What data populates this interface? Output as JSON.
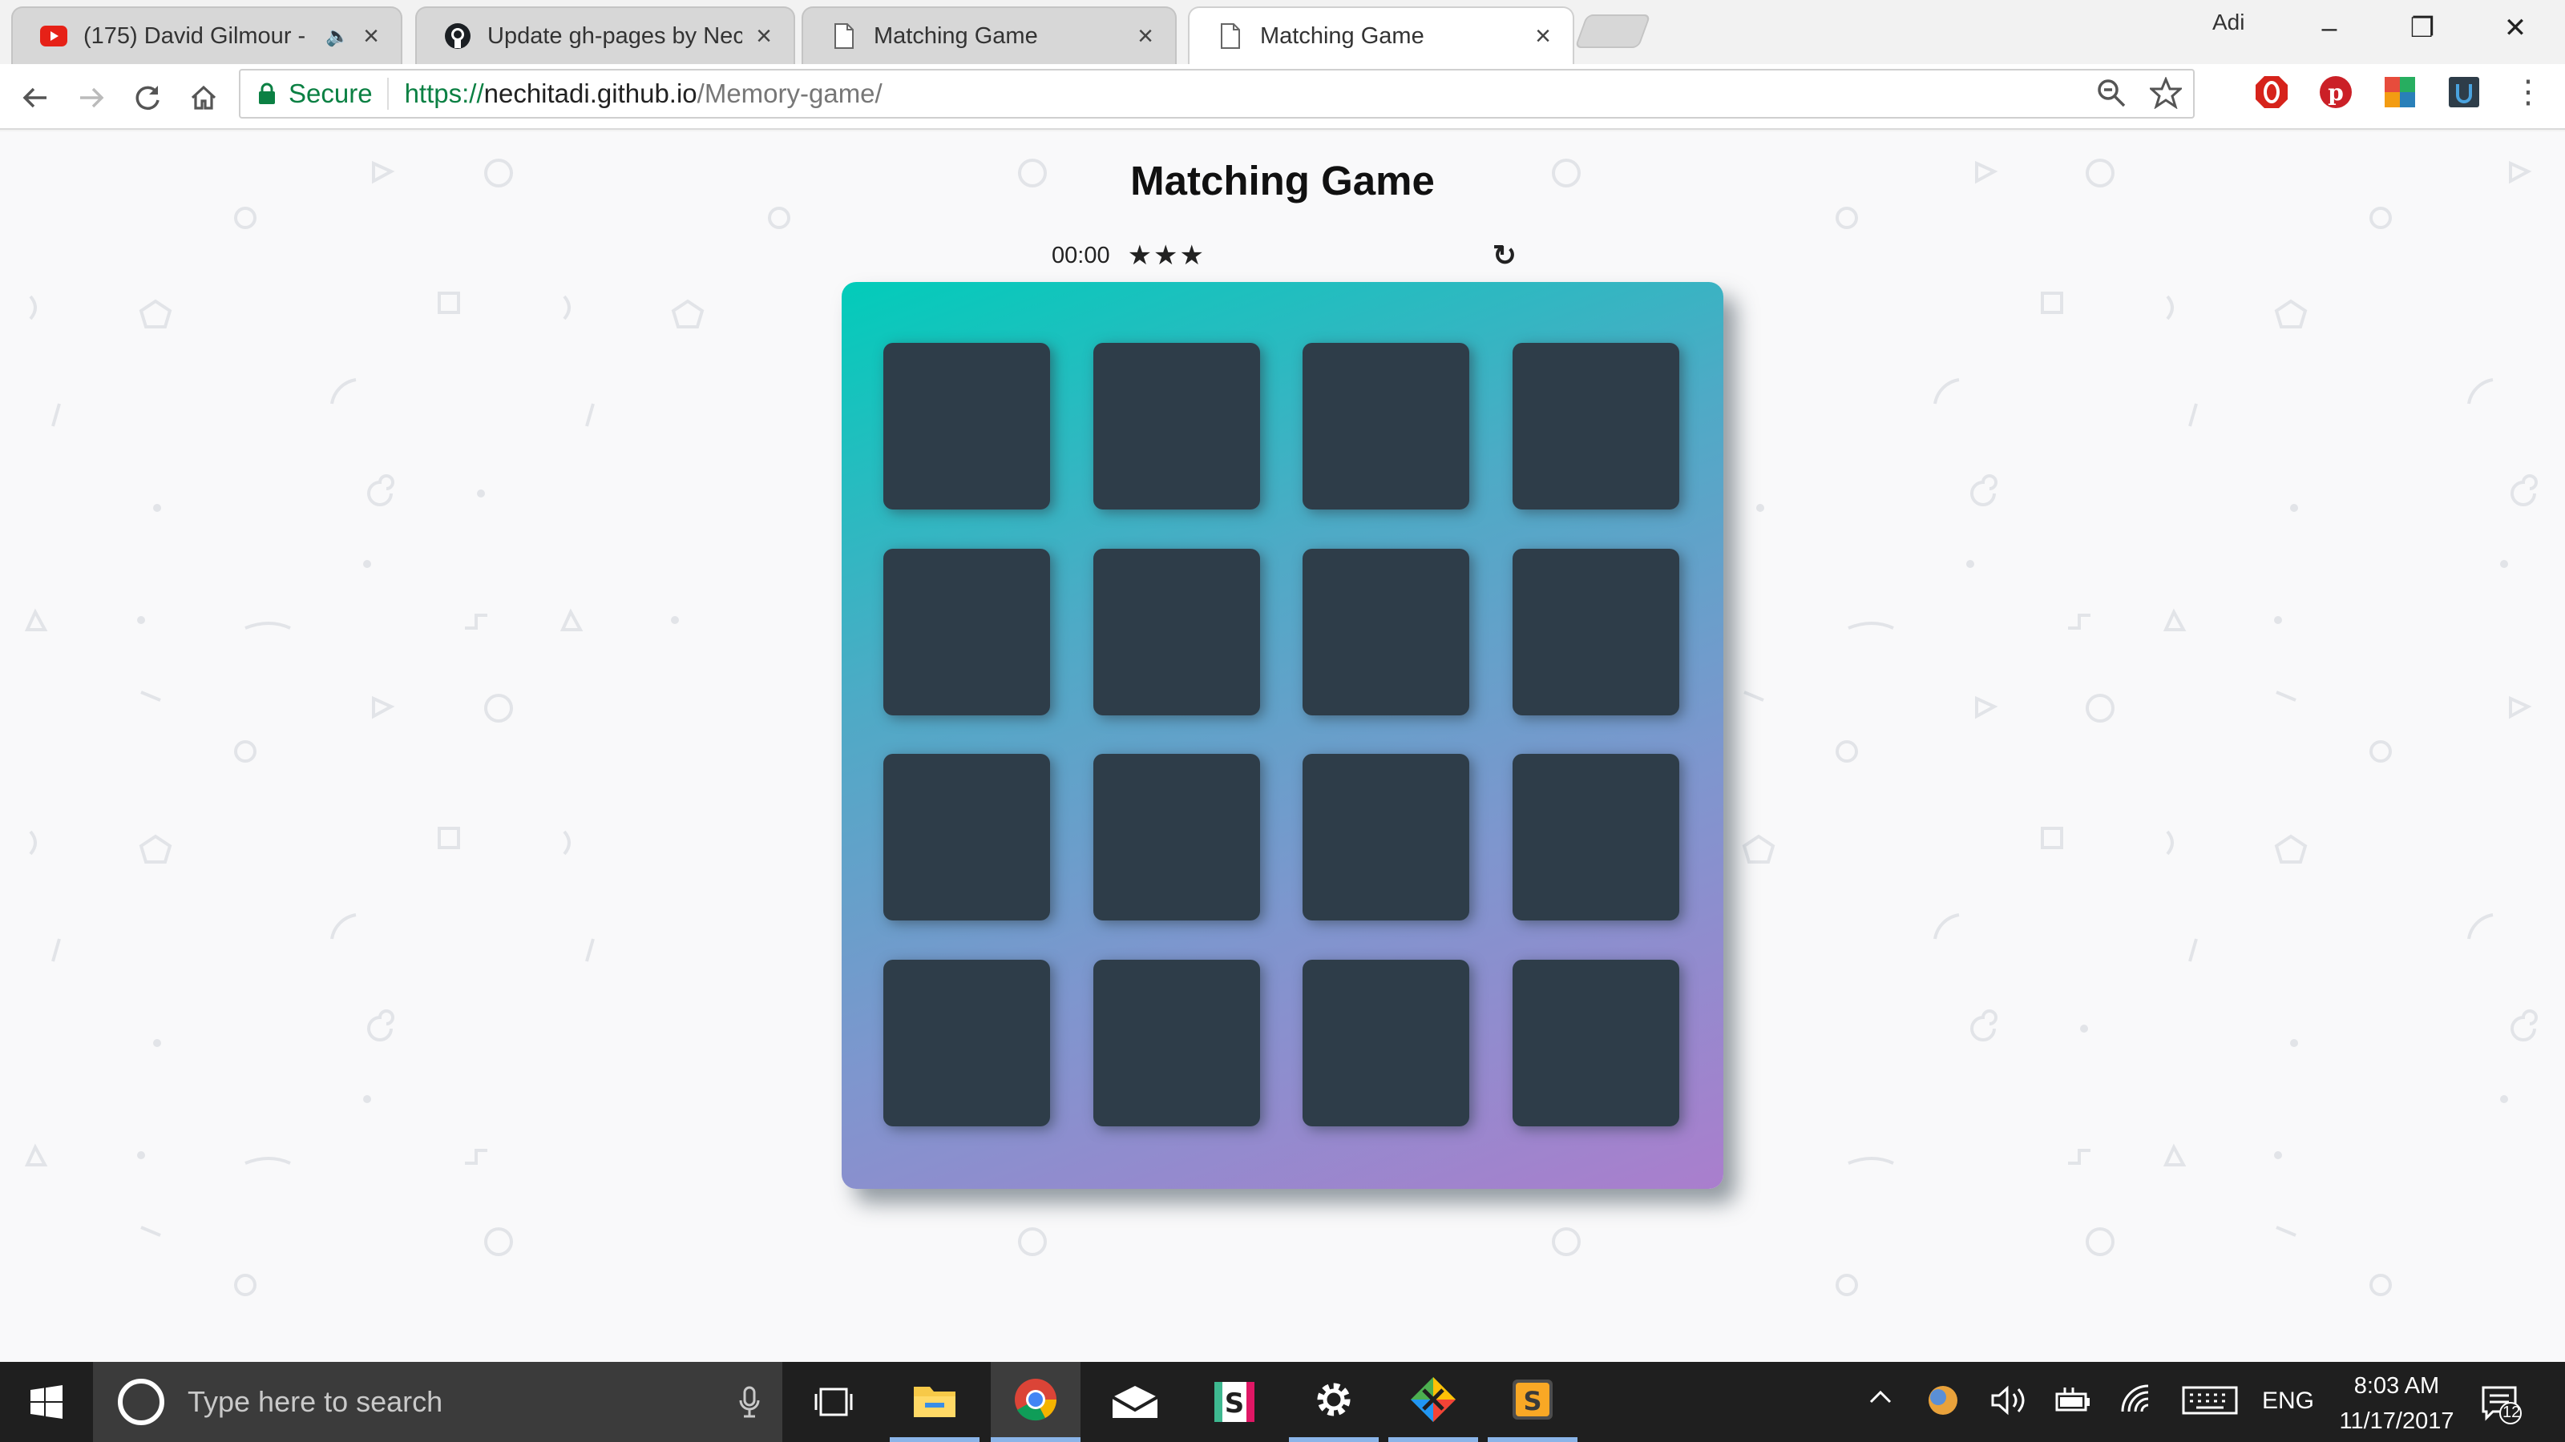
{
  "browser": {
    "tabs": [
      {
        "title": "(175) David Gilmour -",
        "icon": "youtube-icon",
        "has_audio": true,
        "active": false
      },
      {
        "title": "Update gh-pages by Nec",
        "icon": "github-icon",
        "active": false
      },
      {
        "title": "Matching Game",
        "icon": "document-icon",
        "active": false
      },
      {
        "title": "Matching Game",
        "icon": "document-icon",
        "active": true
      }
    ],
    "profile_name": "Adi",
    "window_controls": {
      "minimize": "–",
      "restore": "❐",
      "close": "✕"
    },
    "address": {
      "secure_label": "Secure",
      "url_scheme": "https://",
      "url_host": "nechitadi.github.io",
      "url_path": "/Memory-game/"
    },
    "nav_icons": {
      "back": "back-arrow-icon",
      "forward": "forward-arrow-icon",
      "reload": "reload-icon",
      "home": "home-icon"
    },
    "extensions": [
      "opera-adblock-icon",
      "pinterest-icon",
      "colorpick-icon",
      "extension-icon"
    ]
  },
  "game": {
    "title": "Matching Game",
    "timer": "00:00",
    "stars": "★★★",
    "star_count": 3,
    "restart_icon": "↻",
    "card_count": 16,
    "colors": {
      "deck_start": "#02ccba",
      "deck_end": "#aa7ecd",
      "card": "#2e3d49",
      "background": "#f9f9fa"
    }
  },
  "taskbar": {
    "search_placeholder": "Type here to search",
    "apps": [
      "task-view-icon",
      "file-explorer-icon",
      "chrome-icon",
      "mail-icon",
      "slack-icon",
      "settings-icon",
      "gitkraken-icon",
      "sublime-text-icon"
    ],
    "tray": {
      "language": "ENG",
      "time": "8:03 AM",
      "date": "11/17/2017",
      "notification_count": "12"
    }
  }
}
